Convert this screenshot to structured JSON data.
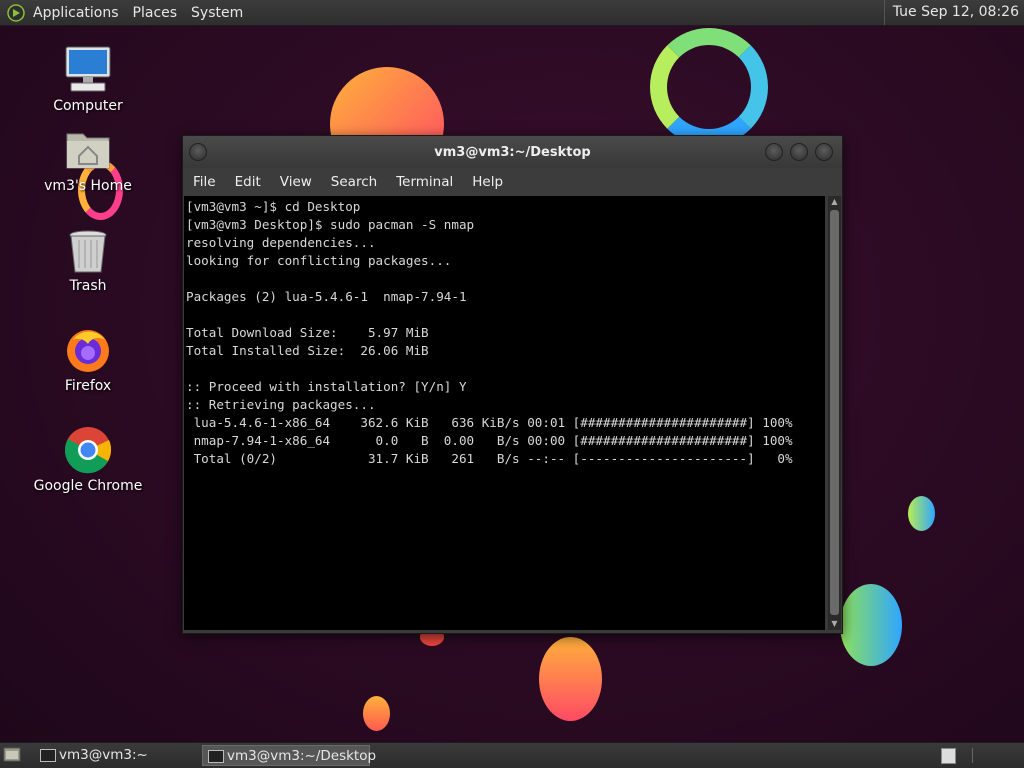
{
  "top_panel": {
    "menus": [
      "Applications",
      "Places",
      "System"
    ],
    "clock": "Tue Sep 12, 08:26"
  },
  "desktop_icons": [
    {
      "label": "Computer",
      "icon": "computer-icon"
    },
    {
      "label": "vm3's Home",
      "icon": "home-folder-icon"
    },
    {
      "label": "Trash",
      "icon": "trash-icon"
    },
    {
      "label": "Firefox",
      "icon": "firefox-icon"
    },
    {
      "label": "Google Chrome",
      "icon": "chrome-icon"
    }
  ],
  "terminal": {
    "title": "vm3@vm3:~/Desktop",
    "menu": [
      "File",
      "Edit",
      "View",
      "Search",
      "Terminal",
      "Help"
    ],
    "lines": [
      "[vm3@vm3 ~]$ cd Desktop",
      "[vm3@vm3 Desktop]$ sudo pacman -S nmap",
      "resolving dependencies...",
      "looking for conflicting packages...",
      "",
      "Packages (2) lua-5.4.6-1  nmap-7.94-1",
      "",
      "Total Download Size:    5.97 MiB",
      "Total Installed Size:  26.06 MiB",
      "",
      ":: Proceed with installation? [Y/n] Y",
      ":: Retrieving packages...",
      " lua-5.4.6-1-x86_64    362.6 KiB   636 KiB/s 00:01 [######################] 100%",
      " nmap-7.94-1-x86_64      0.0   B  0.00   B/s 00:00 [######################] 100%",
      " Total (0/2)            31.7 KiB   261   B/s --:-- [----------------------]   0%"
    ]
  },
  "taskbar": {
    "tasks": [
      {
        "label": "vm3@vm3:~",
        "active": false
      },
      {
        "label": "vm3@vm3:~/Desktop",
        "active": true
      }
    ]
  },
  "colors": {
    "background": "#2a0a22",
    "terminal_bg": "#000000",
    "terminal_fg": "#d8d8d8"
  }
}
